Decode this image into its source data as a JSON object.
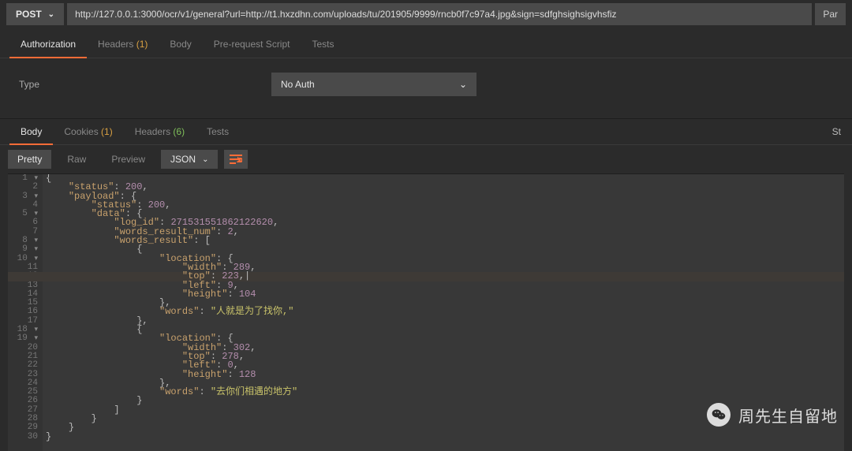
{
  "request": {
    "method": "POST",
    "url": "http://127.0.0.1:3000/ocr/v1/general?url=http://t1.hxzdhn.com/uploads/tu/201905/9999/rncb0f7c97a4.jpg&sign=sdfghsighsigvhsfiz",
    "params_btn": "Par"
  },
  "main_tabs": {
    "authorization": "Authorization",
    "headers_label": "Headers ",
    "headers_count": "(1)",
    "body": "Body",
    "prerequest": "Pre-request Script",
    "tests": "Tests"
  },
  "auth": {
    "type_label": "Type",
    "selected": "No Auth"
  },
  "resp_tabs": {
    "body": "Body",
    "cookies_label": "Cookies ",
    "cookies_count": "(1)",
    "headers_label": "Headers ",
    "headers_count": "(6)",
    "tests": "Tests",
    "status_right": "St"
  },
  "toolbar": {
    "pretty": "Pretty",
    "raw": "Raw",
    "preview": "Preview",
    "format": "JSON"
  },
  "code_lines": [
    {
      "n": "1",
      "f": "-",
      "i": 0,
      "t": [
        [
          "p",
          "{"
        ]
      ]
    },
    {
      "n": "2",
      "i": 1,
      "t": [
        [
          "k",
          "\"status\""
        ],
        [
          "p",
          ": "
        ],
        [
          "n",
          "200"
        ],
        [
          "p",
          ","
        ]
      ]
    },
    {
      "n": "3",
      "f": "-",
      "i": 1,
      "t": [
        [
          "k",
          "\"payload\""
        ],
        [
          "p",
          ": {"
        ]
      ]
    },
    {
      "n": "4",
      "i": 2,
      "t": [
        [
          "k",
          "\"status\""
        ],
        [
          "p",
          ": "
        ],
        [
          "n",
          "200"
        ],
        [
          "p",
          ","
        ]
      ]
    },
    {
      "n": "5",
      "f": "-",
      "i": 2,
      "t": [
        [
          "k",
          "\"data\""
        ],
        [
          "p",
          ": {"
        ]
      ]
    },
    {
      "n": "6",
      "i": 3,
      "t": [
        [
          "k",
          "\"log_id\""
        ],
        [
          "p",
          ": "
        ],
        [
          "n",
          "271531551862122620"
        ],
        [
          "p",
          ","
        ]
      ]
    },
    {
      "n": "7",
      "i": 3,
      "t": [
        [
          "k",
          "\"words_result_num\""
        ],
        [
          "p",
          ": "
        ],
        [
          "n",
          "2"
        ],
        [
          "p",
          ","
        ]
      ]
    },
    {
      "n": "8",
      "f": "-",
      "i": 3,
      "t": [
        [
          "k",
          "\"words_result\""
        ],
        [
          "p",
          ": ["
        ]
      ]
    },
    {
      "n": "9",
      "f": "-",
      "i": 4,
      "t": [
        [
          "p",
          "{"
        ]
      ]
    },
    {
      "n": "10",
      "f": "-",
      "i": 5,
      "t": [
        [
          "k",
          "\"location\""
        ],
        [
          "p",
          ": {"
        ]
      ]
    },
    {
      "n": "11",
      "i": 6,
      "t": [
        [
          "k",
          "\"width\""
        ],
        [
          "p",
          ": "
        ],
        [
          "n",
          "289"
        ],
        [
          "p",
          ","
        ]
      ]
    },
    {
      "n": "12",
      "hl": true,
      "i": 6,
      "t": [
        [
          "k",
          "\"top\""
        ],
        [
          "p",
          ": "
        ],
        [
          "n",
          "223"
        ],
        [
          "p",
          ",|"
        ]
      ]
    },
    {
      "n": "13",
      "i": 6,
      "t": [
        [
          "k",
          "\"left\""
        ],
        [
          "p",
          ": "
        ],
        [
          "n",
          "9"
        ],
        [
          "p",
          ","
        ]
      ]
    },
    {
      "n": "14",
      "i": 6,
      "t": [
        [
          "k",
          "\"height\""
        ],
        [
          "p",
          ": "
        ],
        [
          "n",
          "104"
        ]
      ]
    },
    {
      "n": "15",
      "i": 5,
      "t": [
        [
          "p",
          "},"
        ]
      ]
    },
    {
      "n": "16",
      "i": 5,
      "t": [
        [
          "k",
          "\"words\""
        ],
        [
          "p",
          ": "
        ],
        [
          "s",
          "\"人就是为了找你,\""
        ]
      ]
    },
    {
      "n": "17",
      "i": 4,
      "t": [
        [
          "p",
          "},"
        ]
      ]
    },
    {
      "n": "18",
      "f": "-",
      "i": 4,
      "t": [
        [
          "p",
          "{"
        ]
      ]
    },
    {
      "n": "19",
      "f": "-",
      "i": 5,
      "t": [
        [
          "k",
          "\"location\""
        ],
        [
          "p",
          ": {"
        ]
      ]
    },
    {
      "n": "20",
      "i": 6,
      "t": [
        [
          "k",
          "\"width\""
        ],
        [
          "p",
          ": "
        ],
        [
          "n",
          "302"
        ],
        [
          "p",
          ","
        ]
      ]
    },
    {
      "n": "21",
      "i": 6,
      "t": [
        [
          "k",
          "\"top\""
        ],
        [
          "p",
          ": "
        ],
        [
          "n",
          "278"
        ],
        [
          "p",
          ","
        ]
      ]
    },
    {
      "n": "22",
      "i": 6,
      "t": [
        [
          "k",
          "\"left\""
        ],
        [
          "p",
          ": "
        ],
        [
          "n",
          "0"
        ],
        [
          "p",
          ","
        ]
      ]
    },
    {
      "n": "23",
      "i": 6,
      "t": [
        [
          "k",
          "\"height\""
        ],
        [
          "p",
          ": "
        ],
        [
          "n",
          "128"
        ]
      ]
    },
    {
      "n": "24",
      "i": 5,
      "t": [
        [
          "p",
          "},"
        ]
      ]
    },
    {
      "n": "25",
      "i": 5,
      "t": [
        [
          "k",
          "\"words\""
        ],
        [
          "p",
          ": "
        ],
        [
          "s",
          "\"去你们相遇的地方\""
        ]
      ]
    },
    {
      "n": "26",
      "i": 4,
      "t": [
        [
          "p",
          "}"
        ]
      ]
    },
    {
      "n": "27",
      "i": 3,
      "t": [
        [
          "p",
          "]"
        ]
      ]
    },
    {
      "n": "28",
      "i": 2,
      "t": [
        [
          "p",
          "}"
        ]
      ]
    },
    {
      "n": "29",
      "i": 1,
      "t": [
        [
          "p",
          "}"
        ]
      ]
    },
    {
      "n": "30",
      "i": 0,
      "t": [
        [
          "p",
          "}"
        ]
      ]
    }
  ],
  "watermark": {
    "text": "周先生自留地"
  }
}
